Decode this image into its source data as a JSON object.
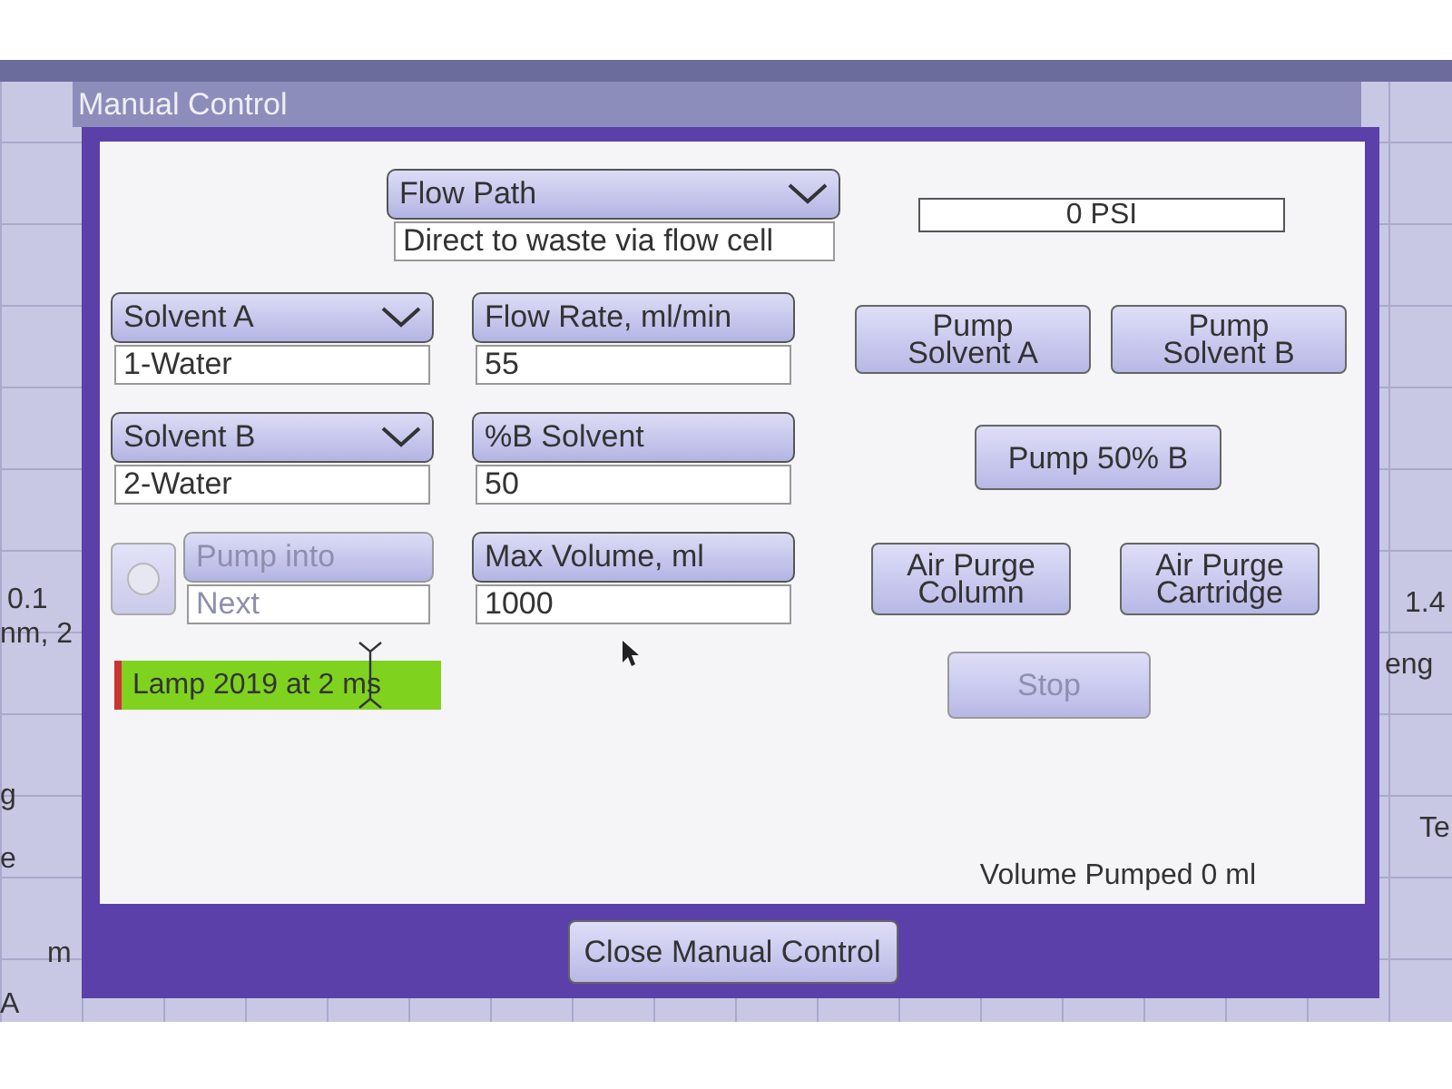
{
  "background": {
    "texts": [
      "0.1",
      "nm, 2",
      "1.4",
      "eng",
      "g",
      "e",
      "m",
      "A",
      "Te"
    ]
  },
  "window": {
    "title": "Manual Control"
  },
  "flow_path": {
    "label": "Flow Path",
    "value": "Direct to waste via flow cell"
  },
  "pressure": "0 PSI",
  "rows": [
    {
      "controls": [
        {
          "kind": "dropdown",
          "label": "Solvent A",
          "value": "1-Water",
          "disabled": false
        },
        {
          "kind": "field",
          "label": "Flow Rate, ml/min",
          "value": "55",
          "disabled": false
        }
      ],
      "buttons": [
        {
          "lines": [
            "Pump",
            "Solvent A"
          ],
          "disabled": false
        },
        {
          "lines": [
            "Pump",
            "Solvent B"
          ],
          "disabled": false
        }
      ]
    },
    {
      "controls": [
        {
          "kind": "dropdown",
          "label": "Solvent B",
          "value": "2-Water",
          "disabled": false
        },
        {
          "kind": "field",
          "label": "%B Solvent",
          "value": "50",
          "disabled": false
        }
      ],
      "buttons": [
        {
          "lines": [
            "Pump 50% B"
          ],
          "disabled": false
        }
      ]
    },
    {
      "controls": [
        {
          "kind": "radio",
          "selected": false,
          "disabled": true
        },
        {
          "kind": "field",
          "label": "Pump into",
          "value": "Next",
          "disabled": true
        },
        {
          "kind": "field",
          "label": "Max Volume, ml",
          "value": "1000",
          "disabled": false
        }
      ],
      "buttons": [
        {
          "lines": [
            "Air Purge",
            "Column"
          ],
          "disabled": false
        },
        {
          "lines": [
            "Air Purge",
            "Cartridge"
          ],
          "disabled": false
        }
      ]
    }
  ],
  "lamp": {
    "text": "Lamp 2019 at 2 ms"
  },
  "stop_button": {
    "label": "Stop",
    "disabled": true
  },
  "volume": "Volume Pumped 0 ml",
  "close_button": "Close Manual Control"
}
